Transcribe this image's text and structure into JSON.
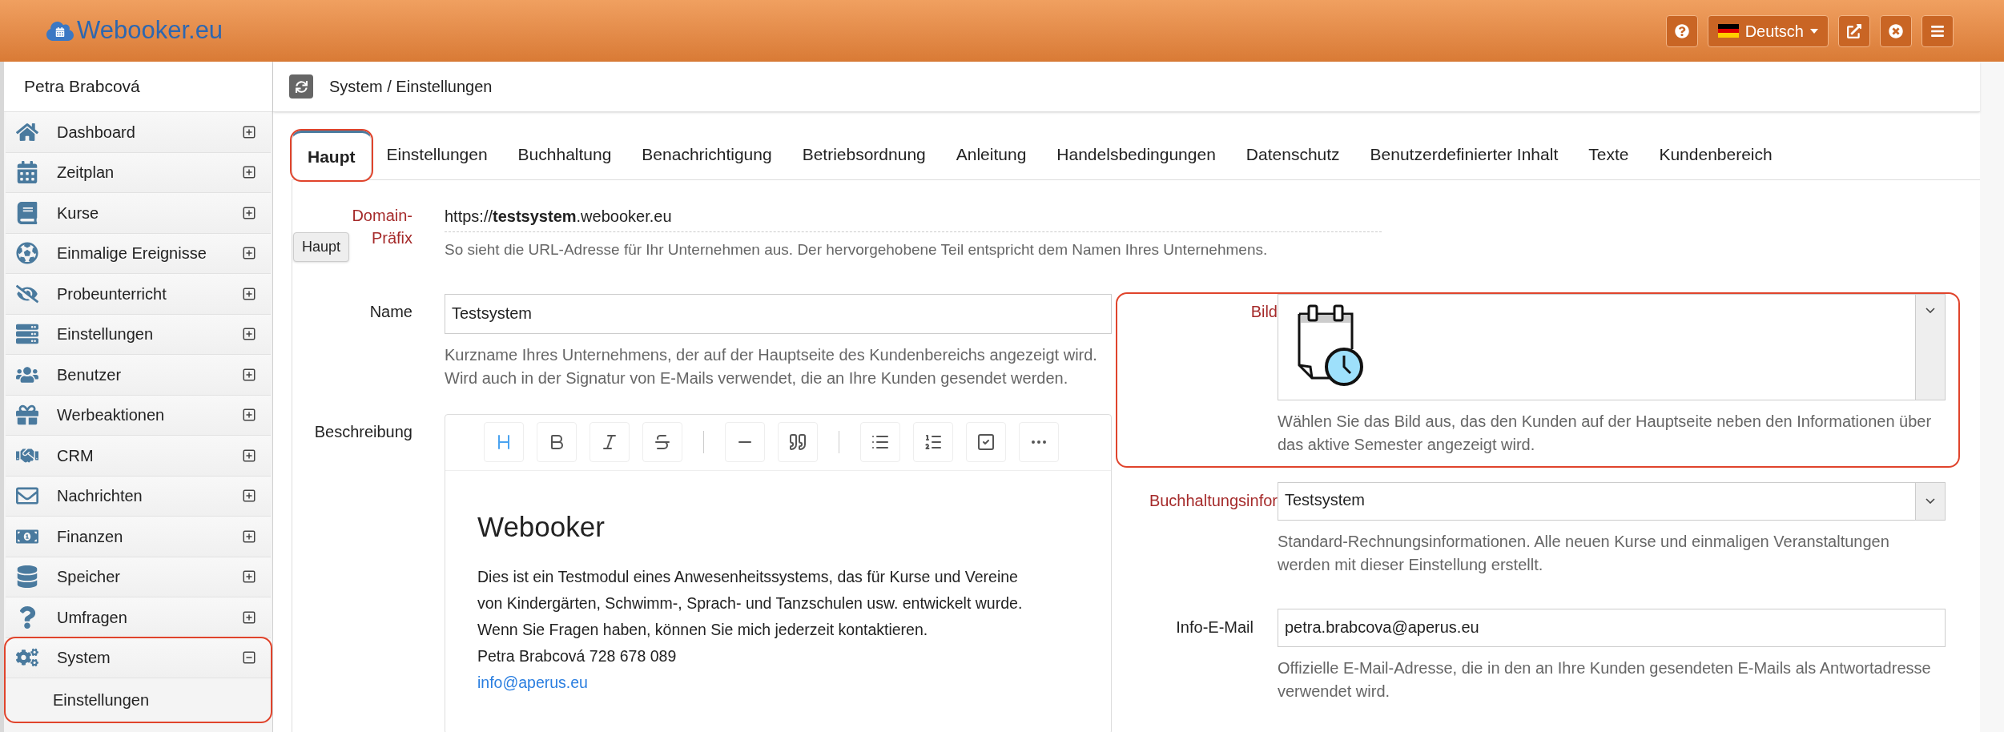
{
  "header": {
    "logo": "Webooker.eu",
    "language": "Deutsch"
  },
  "sidebar": {
    "user": "Petra Brabcová",
    "items": [
      {
        "label": "Dashboard",
        "expanded": false,
        "highlighted": false
      },
      {
        "label": "Zeitplan",
        "expanded": false,
        "highlighted": false
      },
      {
        "label": "Kurse",
        "expanded": false,
        "highlighted": false
      },
      {
        "label": "Einmalige Ereignisse",
        "expanded": false,
        "highlighted": false
      },
      {
        "label": "Probeunterricht",
        "expanded": false,
        "highlighted": false
      },
      {
        "label": "Einstellungen",
        "expanded": false,
        "highlighted": false
      },
      {
        "label": "Benutzer",
        "expanded": false,
        "highlighted": false
      },
      {
        "label": "Werbeaktionen",
        "expanded": false,
        "highlighted": false
      },
      {
        "label": "CRM",
        "expanded": false,
        "highlighted": false
      },
      {
        "label": "Nachrichten",
        "expanded": false,
        "highlighted": false
      },
      {
        "label": "Finanzen",
        "expanded": false,
        "highlighted": false
      },
      {
        "label": "Speicher",
        "expanded": false,
        "highlighted": false
      },
      {
        "label": "Umfragen",
        "expanded": false,
        "highlighted": false
      },
      {
        "label": "System",
        "expanded": true,
        "highlighted": true,
        "children": [
          {
            "label": "Einstellungen"
          }
        ]
      }
    ]
  },
  "breadcrumb": "System / Einstellungen",
  "tabs": [
    {
      "label": "Haupt",
      "selected": true,
      "highlighted": true
    },
    {
      "label": "Einstellungen",
      "selected": false,
      "highlighted": false
    },
    {
      "label": "Buchhaltung",
      "selected": false,
      "highlighted": false
    },
    {
      "label": "Benachrichtigung",
      "selected": false,
      "highlighted": false
    },
    {
      "label": "Betriebsordnung",
      "selected": false,
      "highlighted": false
    },
    {
      "label": "Anleitung",
      "selected": false,
      "highlighted": false
    },
    {
      "label": "Handelsbedingungen",
      "selected": false,
      "highlighted": false
    },
    {
      "label": "Datenschutz",
      "selected": false,
      "highlighted": false
    },
    {
      "label": "Benutzerdefinierter Inhalt",
      "selected": false,
      "highlighted": false
    },
    {
      "label": "Texte",
      "selected": false,
      "highlighted": false
    },
    {
      "label": "Kundenbereich",
      "selected": false,
      "highlighted": false
    }
  ],
  "tooltip": "Haupt",
  "form": {
    "domain": {
      "label": "Domain-Präfix",
      "required": true,
      "value": "https://**testsystem**.webooker.eu",
      "help": "So sieht die URL-Adresse für Ihr Unternehmen aus. Der hervorgehobene Teil entspricht dem Namen Ihres Unternehmens."
    },
    "name": {
      "label": "Name",
      "required": false,
      "value": "Testsystem",
      "help": "Kurzname Ihres Unternehmens, der auf der Hauptseite des Kundenbereichs angezeigt wird. Wird auch in der Signatur von E-Mails verwendet, die an Ihre Kunden gesendet werden."
    },
    "description": {
      "label": "Beschreibung",
      "required": false,
      "heading": "Webooker",
      "lines": [
        "Dies ist ein Testmodul eines Anwesenheitssystems, das für Kurse und Vereine",
        "von Kindergärten, Schwimm-, Sprach- und Tanzschulen usw. entwickelt wurde.",
        "Wenn Sie Fragen haben, können Sie mich jederzeit kontaktieren.",
        "Petra Brabcová 728 678 089"
      ],
      "link": "info@aperus.eu"
    },
    "image": {
      "label": "Bild",
      "required": true,
      "highlighted": true,
      "help": "Wählen Sie das Bild aus, das den Kunden auf der Hauptseite neben den Informationen über das aktive Semester angezeigt wird."
    },
    "accounting": {
      "label": "Buchhaltungsinfor",
      "required": true,
      "value": "Testsystem",
      "help": "Standard-Rechnungsinformationen. Alle neuen Kurse und einmaligen Veranstaltungen werden mit dieser Einstellung erstellt."
    },
    "email": {
      "label": "Info-E-Mail",
      "required": false,
      "value": "petra.brabcova@aperus.eu",
      "help": "Offizielle E-Mail-Adresse, die in den an Ihre Kunden gesendeten E-Mails als Antwortadresse verwendet wird."
    }
  }
}
